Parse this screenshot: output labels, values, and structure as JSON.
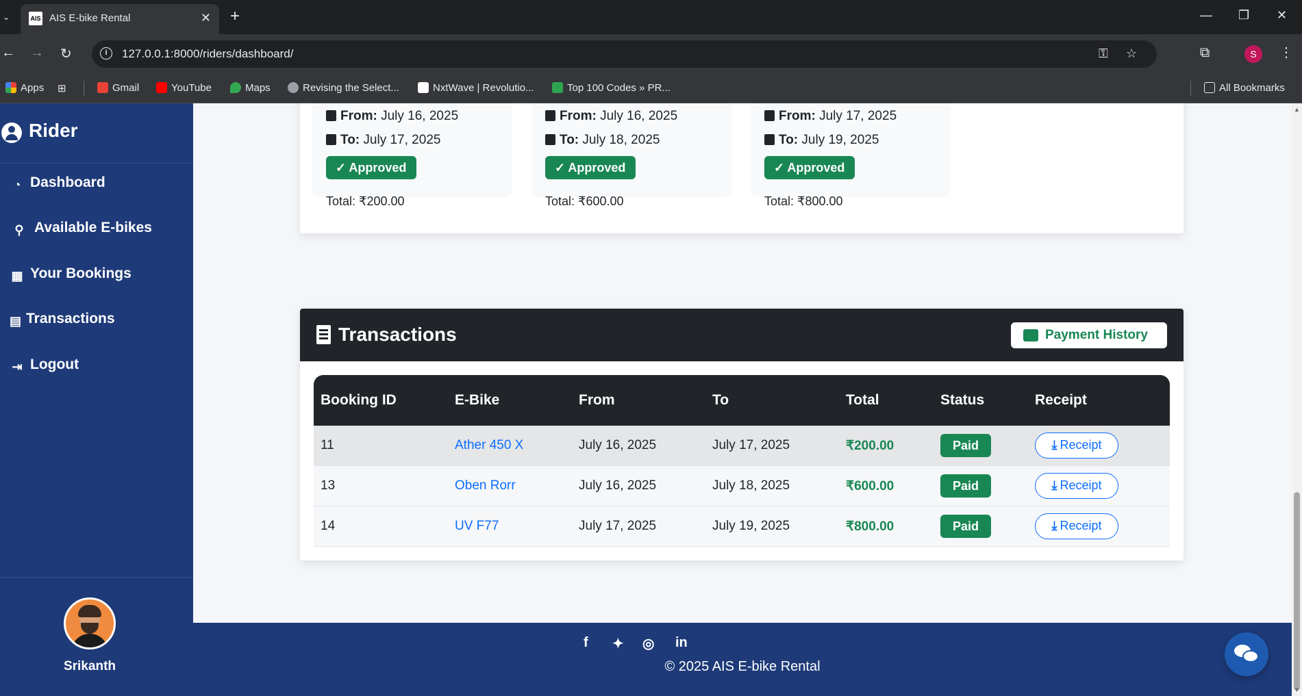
{
  "browser": {
    "tab_title": "AIS E-bike Rental",
    "tab_favicon": "AIS",
    "url": "127.0.0.1:8000/riders/dashboard/",
    "profile_initial": "S",
    "bookmarks": [
      {
        "label": "Apps",
        "icon": "apps-grid-icon"
      },
      {
        "label": "Gmail",
        "icon": "gmail-icon"
      },
      {
        "label": "YouTube",
        "icon": "youtube-icon"
      },
      {
        "label": "Maps",
        "icon": "maps-icon"
      },
      {
        "label": "Revising the Select...",
        "icon": "globe-icon"
      },
      {
        "label": "NxtWave | Revolutio...",
        "icon": "nxtwave-icon"
      },
      {
        "label": "Top 100 Codes » PR...",
        "icon": "codes-icon"
      }
    ],
    "all_bookmarks": "All Bookmarks"
  },
  "sidebar": {
    "brand": "Rider",
    "items": [
      {
        "label": "Dashboard",
        "icon": "dashboard-gauge-icon"
      },
      {
        "label": "Available E-bikes",
        "icon": "bicycle-icon"
      },
      {
        "label": "Your Bookings",
        "icon": "calendar-check-icon"
      },
      {
        "label": "Transactions",
        "icon": "receipt-icon"
      },
      {
        "label": "Logout",
        "icon": "logout-icon"
      }
    ],
    "user_name": "Srikanth"
  },
  "bookings": [
    {
      "from_label": "From:",
      "from": "July 16, 2025",
      "to_label": "To:",
      "to": "July 17, 2025",
      "status": "Approved",
      "total": "Total: ₹200.00"
    },
    {
      "from_label": "From:",
      "from": "July 16, 2025",
      "to_label": "To:",
      "to": "July 18, 2025",
      "status": "Approved",
      "total": "Total: ₹600.00"
    },
    {
      "from_label": "From:",
      "from": "July 17, 2025",
      "to_label": "To:",
      "to": "July 19, 2025",
      "status": "Approved",
      "total": "Total: ₹800.00"
    }
  ],
  "transactions": {
    "title": "Transactions",
    "payment_history_label": "Payment History",
    "columns": [
      "Booking ID",
      "E-Bike",
      "From",
      "To",
      "Total",
      "Status",
      "Receipt"
    ],
    "rows": [
      {
        "id": "11",
        "bike": "Ather 450 X",
        "from": "July 16, 2025",
        "to": "July 17, 2025",
        "total": "₹200.00",
        "status": "Paid",
        "receipt": "Receipt"
      },
      {
        "id": "13",
        "bike": "Oben Rorr",
        "from": "July 16, 2025",
        "to": "July 18, 2025",
        "total": "₹600.00",
        "status": "Paid",
        "receipt": "Receipt"
      },
      {
        "id": "14",
        "bike": "UV F77",
        "from": "July 17, 2025",
        "to": "July 19, 2025",
        "total": "₹800.00",
        "status": "Paid",
        "receipt": "Receipt"
      }
    ]
  },
  "footer": {
    "social": [
      "facebook-icon",
      "twitter-icon",
      "instagram-icon",
      "linkedin-icon"
    ],
    "copyright": "© 2025 AIS E-bike Rental"
  },
  "colors": {
    "sidebar_bg": "#1e3a78",
    "success_green": "#198754",
    "link_blue": "#0d6efd",
    "header_dark": "#212529"
  }
}
